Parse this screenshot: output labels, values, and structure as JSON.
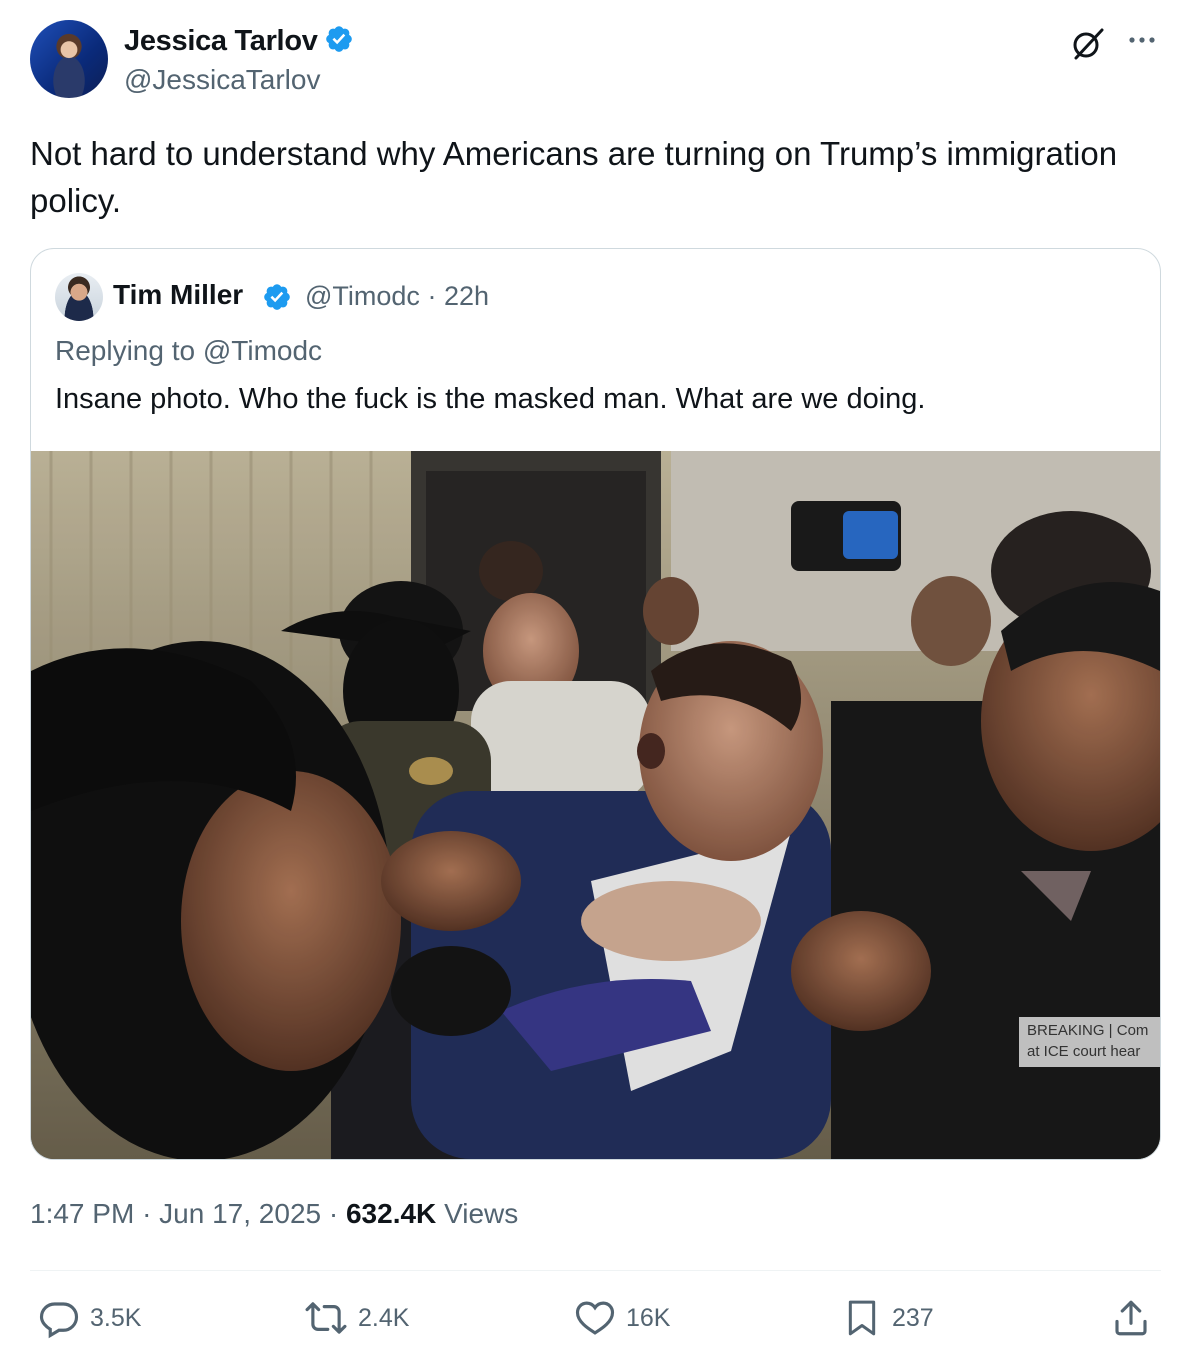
{
  "author": {
    "name": "Jessica Tarlov",
    "handle": "@JessicaTarlov",
    "verified": true
  },
  "tweet": {
    "text": "Not hard to understand why Americans are turning on Trump’s immigration policy."
  },
  "quoted": {
    "name": "Tim Miller",
    "handle": "@Timodc",
    "separator": "·",
    "age": "22h",
    "replying_to": "Replying to @Timodc",
    "text": "Insane photo. Who the fuck is the masked man. What are we doing.",
    "photo_caption_line1": "BREAKING | Com",
    "photo_caption_line2": "at ICE court hear"
  },
  "meta": {
    "time": "1:47 PM",
    "date": "Jun 17, 2025",
    "separator": "·",
    "views_count": "632.4K",
    "views_label": "Views"
  },
  "actions": {
    "replies": "3.5K",
    "reposts": "2.4K",
    "likes": "16K",
    "bookmarks": "237"
  },
  "colors": {
    "text": "#0f1419",
    "secondary": "#536471",
    "verified": "#1d9bf0",
    "border": "#cfd9de"
  }
}
